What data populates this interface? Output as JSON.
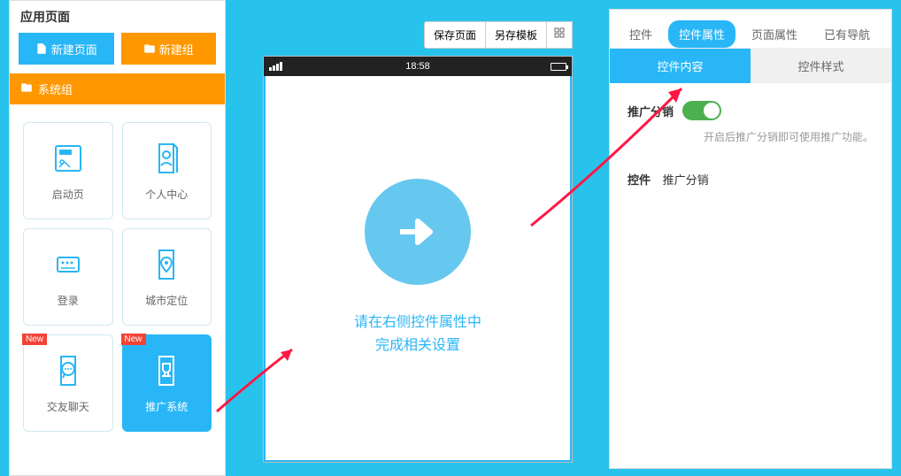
{
  "left": {
    "title": "应用页面",
    "new_page": "新建页面",
    "new_group": "新建组",
    "group_name": "系统组",
    "cards": [
      {
        "label": "启动页",
        "new": false
      },
      {
        "label": "个人中心",
        "new": false
      },
      {
        "label": "登录",
        "new": false
      },
      {
        "label": "城市定位",
        "new": false
      },
      {
        "label": "交友聊天",
        "new": true
      },
      {
        "label": "推广系统",
        "new": true,
        "active": true
      }
    ],
    "new_badge": "New"
  },
  "toolbar": {
    "save": "保存页面",
    "save_template": "另存模板"
  },
  "phone": {
    "time": "18:58",
    "help_line1": "请在右侧控件属性中",
    "help_line2": "完成相关设置"
  },
  "right": {
    "tabs": [
      "控件",
      "控件属性",
      "页面属性",
      "已有导航"
    ],
    "active_tab": 1,
    "subtabs": [
      "控件内容",
      "控件样式"
    ],
    "active_subtab": 0,
    "toggle_label": "推广分销",
    "toggle_hint": "开启后推广分销即可使用推广功能。",
    "section_key": "控件",
    "section_val": "推广分销"
  }
}
